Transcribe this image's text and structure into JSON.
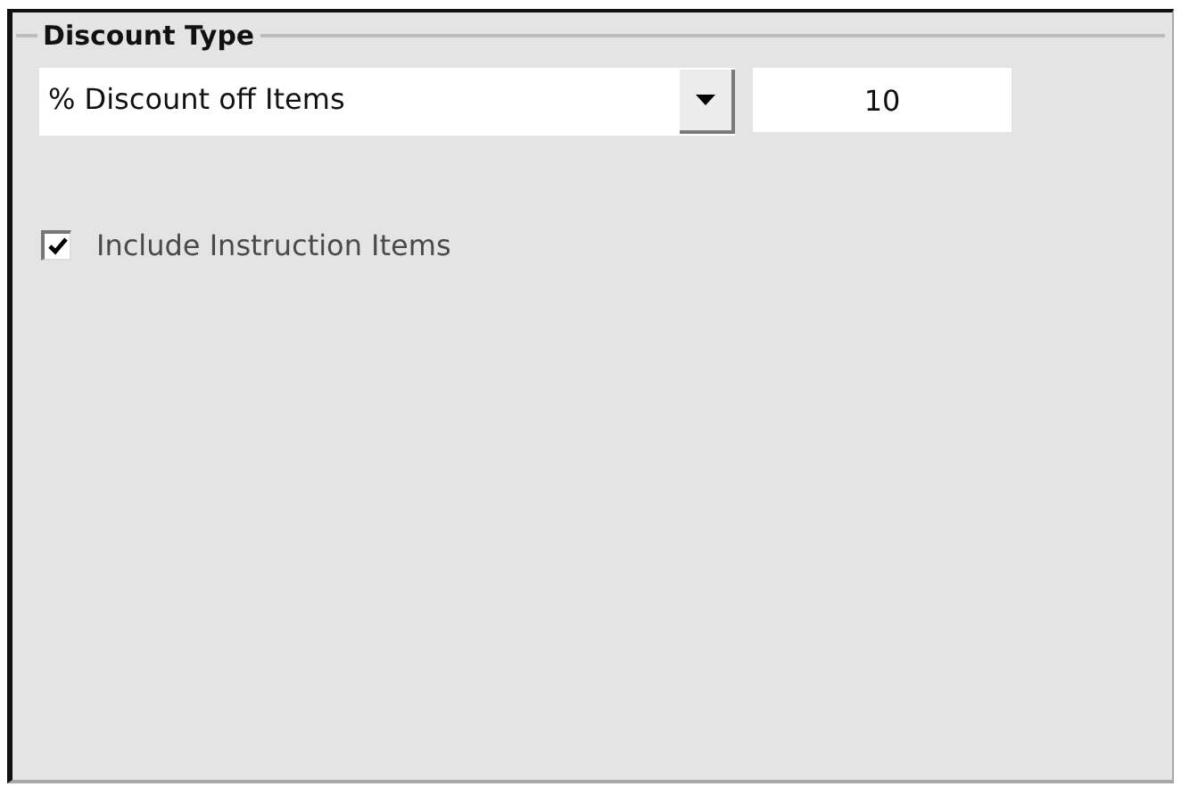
{
  "group": {
    "title": "Discount Type"
  },
  "discount_select": {
    "value": "% Discount off Items"
  },
  "amount_field": {
    "value": "10"
  },
  "include_instruction_items": {
    "label": "Include Instruction Items",
    "checked": true
  }
}
